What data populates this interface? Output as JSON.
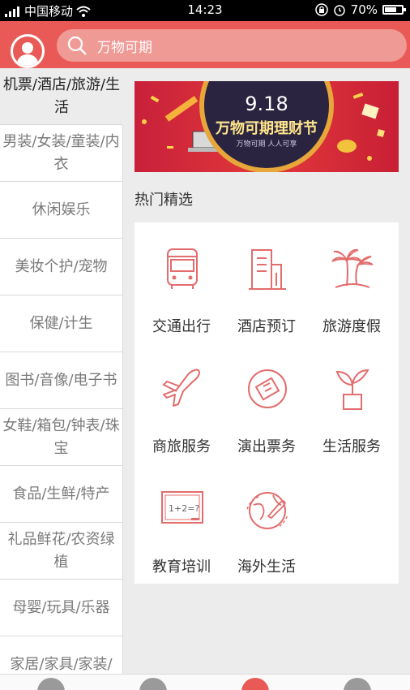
{
  "status": {
    "carrier": "中国移动",
    "time": "14:23",
    "battery": "70%"
  },
  "search": {
    "placeholder": "万物可期"
  },
  "sidebar": {
    "items": [
      {
        "label": "机票/酒店/旅游/生活",
        "active": true
      },
      {
        "label": "男装/女装/童装/内衣"
      },
      {
        "label": "休闲娱乐"
      },
      {
        "label": "美妆个护/宠物"
      },
      {
        "label": "保健/计生"
      },
      {
        "label": "图书/音像/电子书"
      },
      {
        "label": "女鞋/箱包/钟表/珠宝"
      },
      {
        "label": "食品/生鲜/特产"
      },
      {
        "label": "礼品鲜花/农资绿植"
      },
      {
        "label": "母婴/玩具/乐器"
      },
      {
        "label": "家居/家具/家装/"
      }
    ]
  },
  "banner": {
    "date": "9.18",
    "title": "万物可期理财节",
    "tagline": "万物可期 人人可享"
  },
  "section": {
    "title": "热门精选"
  },
  "services": [
    {
      "label": "交通出行",
      "icon": "bus-icon"
    },
    {
      "label": "酒店预订",
      "icon": "hotel-icon"
    },
    {
      "label": "旅游度假",
      "icon": "palm-tree-icon"
    },
    {
      "label": "商旅服务",
      "icon": "airplane-icon"
    },
    {
      "label": "演出票务",
      "icon": "ticket-icon"
    },
    {
      "label": "生活服务",
      "icon": "plant-icon"
    },
    {
      "label": "教育培训",
      "icon": "blackboard-icon"
    },
    {
      "label": "海外生活",
      "icon": "globe-plane-icon"
    }
  ],
  "colors": {
    "brand": "#e95a56",
    "icon": "#e36c6c"
  }
}
